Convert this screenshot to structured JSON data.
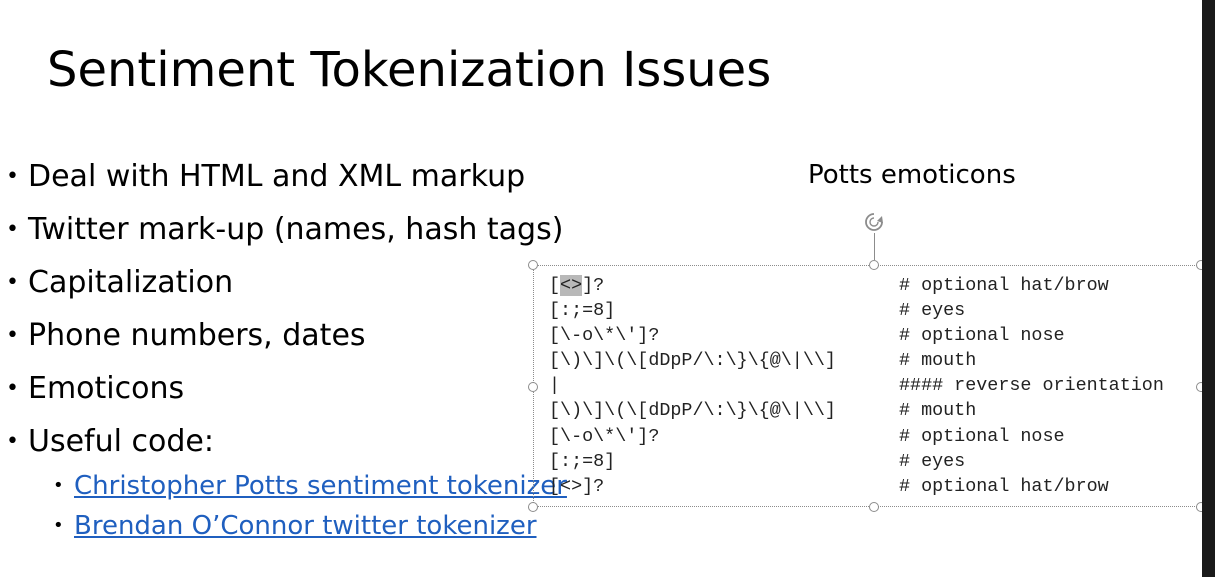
{
  "slide": {
    "title": "Sentiment Tokenization Issues",
    "bullets": [
      "Deal with HTML and XML markup",
      "Twitter mark-up (names, hash tags)",
      "Capitalization",
      "Phone numbers, dates",
      "Emoticons",
      "Useful code:"
    ],
    "sub_bullets": [
      "Christopher Potts sentiment tokenizer",
      "Brendan O’Connor twitter tokenizer"
    ],
    "caption": "Potts emoticons",
    "code": [
      {
        "left_pre": "[",
        "left_hl": "<>",
        "left_post": "]?",
        "right": "# optional hat/brow"
      },
      {
        "left_pre": "[:;=8]",
        "left_hl": "",
        "left_post": "",
        "right": "# eyes"
      },
      {
        "left_pre": "[\\-o\\*\\']?",
        "left_hl": "",
        "left_post": "",
        "right": "# optional nose"
      },
      {
        "left_pre": "[\\)\\]\\(\\[dDpP/\\:\\}\\{@\\|\\\\]",
        "left_hl": "",
        "left_post": "",
        "right": "# mouth"
      },
      {
        "left_pre": "|",
        "left_hl": "",
        "left_post": "",
        "right": "#### reverse orientation"
      },
      {
        "left_pre": "[\\)\\]\\(\\[dDpP/\\:\\}\\{@\\|\\\\]",
        "left_hl": "",
        "left_post": "",
        "right": "# mouth"
      },
      {
        "left_pre": "[\\-o\\*\\']?",
        "left_hl": "",
        "left_post": "",
        "right": "# optional nose"
      },
      {
        "left_pre": "[:;=8]",
        "left_hl": "",
        "left_post": "",
        "right": "# eyes"
      },
      {
        "left_pre": "[<>]?",
        "left_hl": "",
        "left_post": "",
        "right": "# optional hat/brow"
      }
    ]
  },
  "colors": {
    "link": "#1f5fbf",
    "selection_border": "#8c8c8c",
    "highlight": "#b8b8b8"
  }
}
